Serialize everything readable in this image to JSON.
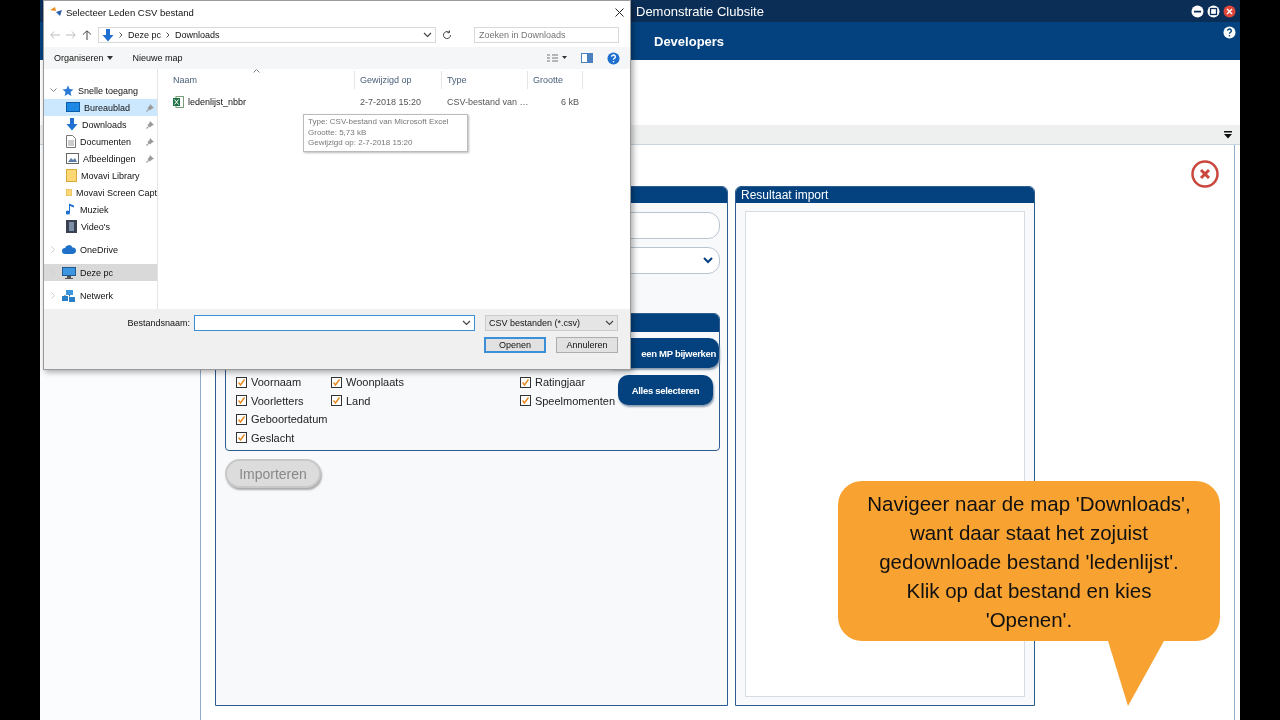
{
  "app": {
    "title": "Demonstratie Clubsite",
    "nav_title": "Developers",
    "import_panel": {
      "checkbox_columns": [
        [
          {
            "label": "Voornaam",
            "checked": true
          },
          {
            "label": "Voorletters",
            "checked": true
          },
          {
            "label": "Geboortedatum",
            "checked": true
          },
          {
            "label": "Geslacht",
            "checked": true
          }
        ],
        [
          {
            "label": "Woonplaats",
            "checked": true
          },
          {
            "label": "Land",
            "checked": true
          }
        ],
        [
          {
            "label": "Ratingjaar",
            "checked": true
          },
          {
            "label": "Speelmomenten",
            "checked": true
          }
        ]
      ],
      "buttons": [
        "een MP bijwerken",
        "Alles selecteren"
      ],
      "import_button": {
        "label": "Importeren",
        "disabled": true
      }
    },
    "result_panel": {
      "title": "Resultaat import"
    }
  },
  "dialog": {
    "title": "Selecteer Leden CSV bestand",
    "path": [
      "Deze pc",
      "Downloads"
    ],
    "search": {
      "placeholder": "Zoeken in Downloads"
    },
    "toolbar": [
      "Organiseren",
      "Nieuwe map"
    ],
    "nav": [
      {
        "label": "Snelle toegang",
        "kind": "star",
        "expanded": true,
        "selected": false,
        "hovered": false,
        "children": [
          {
            "label": "Bureaublad",
            "kind": "desktop",
            "pinned": true,
            "selected": false,
            "hovered": true
          },
          {
            "label": "Downloads",
            "kind": "download",
            "pinned": true,
            "selected": false,
            "hovered": false
          },
          {
            "label": "Documenten",
            "kind": "document",
            "pinned": true,
            "selected": false,
            "hovered": false
          },
          {
            "label": "Afbeeldingen",
            "kind": "pictures",
            "pinned": true,
            "selected": false,
            "hovered": false
          },
          {
            "label": "Movavi Library",
            "kind": "folder",
            "pinned": false,
            "selected": false,
            "hovered": false
          },
          {
            "label": "Movavi Screen Capt",
            "kind": "folder",
            "pinned": false,
            "selected": false,
            "hovered": false
          },
          {
            "label": "Muziek",
            "kind": "music",
            "pinned": false,
            "selected": false,
            "hovered": false
          },
          {
            "label": "Video's",
            "kind": "video",
            "pinned": false,
            "selected": false,
            "hovered": false
          }
        ]
      },
      {
        "label": "OneDrive",
        "kind": "cloud",
        "expanded": false,
        "selected": false,
        "hovered": false
      },
      {
        "label": "Deze pc",
        "kind": "pc",
        "expanded": false,
        "selected": true,
        "hovered": false
      },
      {
        "label": "Netwerk",
        "kind": "network",
        "expanded": false,
        "selected": false,
        "hovered": false
      }
    ],
    "columns": [
      "Naam",
      "Gewijzigd op",
      "Type",
      "Grootte"
    ],
    "files": [
      {
        "name": "ledenlijst_nbbr",
        "modified": "2-7-2018 15:20",
        "type": "CSV-bestand van …",
        "size": "6 kB"
      }
    ],
    "tooltip": [
      "Type: CSV-bestand van Microsoft Excel",
      "Grootte: 5,73 kB",
      "Gewijzigd op: 2-7-2018 15:20"
    ],
    "filename_label": "Bestandsnaam:",
    "filter": "CSV bestanden (*.csv)",
    "buttons": [
      "Openen",
      "Annuleren"
    ]
  },
  "callout": {
    "text": "Navigeer naar de map 'Downloads', want daar staat het zojuist gedownloade bestand 'ledenlijst'. Klik op dat bestand en kies 'Openen'."
  }
}
